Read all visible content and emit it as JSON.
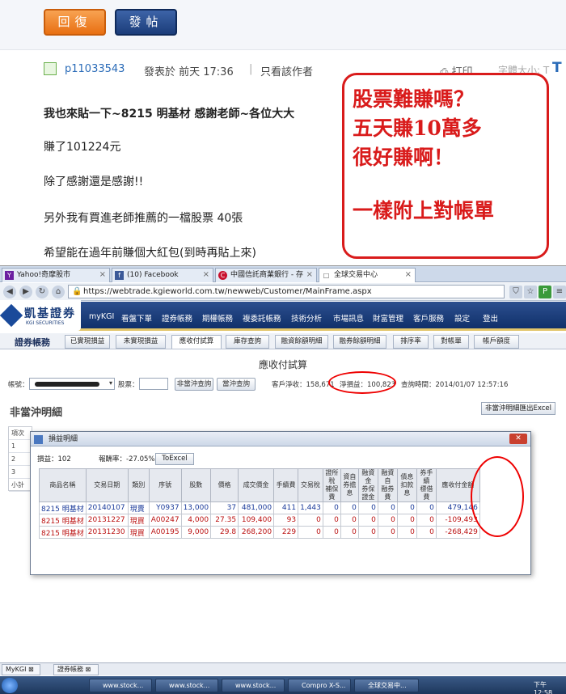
{
  "forum": {
    "reply_button": "回復",
    "post_button": "發帖",
    "username": "p11033543",
    "posted_at": "發表於 前天 17:36",
    "separator": "|",
    "author_only": "只看該作者",
    "print": "打印",
    "font_size": "字體大小: T",
    "corner_letter": "T",
    "lines": [
      "我也來貼一下~8215 明基材 感謝老師~各位大大",
      "賺了101224元",
      "除了感謝還是感謝!!",
      "另外我有買進老師推薦的一檔股票 40張",
      "希望能在過年前賺個大紅包(到時再貼上來)"
    ]
  },
  "annotation": {
    "line1": "股票難賺嗎？",
    "line2": "五天賺10萬多",
    "line3": "很好賺啊！",
    "line4": "一樣附上對帳單",
    "color": "#d91b1b"
  },
  "browser": {
    "tabs": [
      {
        "label": "Yahoo!奇摩股市",
        "icon": "Y"
      },
      {
        "label": "(10) Facebook",
        "icon": "f"
      },
      {
        "label": "中國信託商業銀行 - 存",
        "icon": "C"
      },
      {
        "label": "全球交易中心",
        "icon": "□"
      }
    ],
    "url": "https://webtrade.kgieworld.com.tw/newweb/Customer/MainFrame.aspx"
  },
  "kgi": {
    "logo_name": "凱基證券",
    "logo_en": "KGI SECURITIES",
    "menu": [
      "myKGI",
      "看盤下單",
      "證券帳務",
      "期權帳務",
      "複委託帳務",
      "技術分析",
      "市場訊息",
      "財富管理",
      "客戶服務",
      "設定",
      "登出"
    ],
    "section": "證券帳務",
    "subtabs": [
      "已實現損益",
      "未實現損益",
      "應收付試算",
      "庫存查詢",
      "融資餘額明細",
      "融券餘額明細",
      "排序率",
      "對帳單",
      "帳戶額度"
    ],
    "calc_title": "應收付試算",
    "account_label": "帳號：",
    "stock_label": "股票：",
    "btn_nonday": "非當沖查詢",
    "btn_day": "當沖查詢",
    "net_income": "客戶淨收：158,671",
    "net_pl": "淨損益：100,823",
    "query_time": "查詢時間：2014/01/07 12:57:16",
    "non_day_title": "非當沖明細",
    "export_btn": "非當沖明細匯出Excel",
    "bg_rows": [
      "項次",
      "1",
      "2",
      "3",
      "小計"
    ]
  },
  "dialog": {
    "title": "損益明細",
    "pl_label": "損益：102",
    "roi_label": "報酬率：-27.05%",
    "toexcel": "ToExcel",
    "headers": [
      "商品名稱",
      "交易日期",
      "類別",
      "序號",
      "股數",
      "價格",
      "成交價金",
      "手續費",
      "交易稅",
      "證所稅\n補保費",
      "資自\n券擔息",
      "融資金\n券保證金",
      "融資自\n融券費",
      "債息\n扣款息",
      "券手續\n標借費",
      "應收付金額"
    ],
    "rows": [
      [
        "8215 明基材",
        "20140107",
        "現賣",
        "Y0937",
        "13,000",
        "37",
        "481,000",
        "411",
        "1,443",
        "0",
        "0",
        "0",
        "0",
        "0",
        "0",
        "479,146"
      ],
      [
        "8215 明基材",
        "20131227",
        "現買",
        "A00247",
        "4,000",
        "27.35",
        "109,400",
        "93",
        "0",
        "0",
        "0",
        "0",
        "0",
        "0",
        "0",
        "-109,493"
      ],
      [
        "8215 明基材",
        "20131230",
        "現買",
        "A00195",
        "9,000",
        "29.8",
        "268,200",
        "229",
        "0",
        "0",
        "0",
        "0",
        "0",
        "0",
        "0",
        "-268,429"
      ]
    ]
  },
  "taskbar": {
    "bottom_tabs": [
      "MyKGI",
      "證券帳務"
    ],
    "tasks": [
      "www.stock...",
      "www.stock...",
      "www.stock...",
      "Compro X-S...",
      "全球交易中..."
    ],
    "clock": "下午 12:58"
  }
}
